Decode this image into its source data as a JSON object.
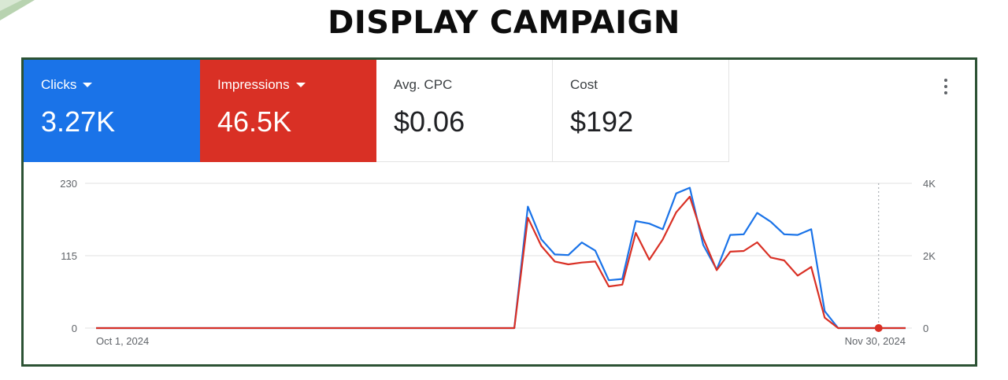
{
  "page": {
    "title": "DISPLAY CAMPAIGN"
  },
  "metrics": [
    {
      "label": "Clicks",
      "value": "3.27K",
      "color": "#1a73e8",
      "has_dropdown": true
    },
    {
      "label": "Impressions",
      "value": "46.5K",
      "color": "#d93025",
      "has_dropdown": true
    },
    {
      "label": "Avg. CPC",
      "value": "$0.06"
    },
    {
      "label": "Cost",
      "value": "$192"
    }
  ],
  "chart_data": {
    "type": "line",
    "x_start_label": "Oct 1, 2024",
    "x_end_label": "Nov 30, 2024",
    "days": 61,
    "left_axis": {
      "ticks": [
        "0",
        "115",
        "230"
      ],
      "ylim": [
        0,
        230
      ]
    },
    "right_axis": {
      "ticks": [
        "0",
        "2K",
        "4K"
      ],
      "ylim": [
        0,
        4000
      ]
    },
    "grid": true,
    "series": [
      {
        "axis": "left",
        "color": "#1a73e8",
        "values": [
          0,
          0,
          0,
          0,
          0,
          0,
          0,
          0,
          0,
          0,
          0,
          0,
          0,
          0,
          0,
          0,
          0,
          0,
          0,
          0,
          0,
          0,
          0,
          0,
          0,
          0,
          0,
          0,
          0,
          0,
          0,
          0,
          193,
          141,
          117,
          116,
          136,
          123,
          76,
          78,
          170,
          166,
          157,
          214,
          223,
          132,
          93,
          148,
          149,
          183,
          169,
          149,
          148,
          157,
          27,
          0,
          0,
          0,
          0,
          0,
          0
        ]
      },
      {
        "axis": "right",
        "color": "#d93025",
        "values": [
          0,
          0,
          0,
          0,
          0,
          0,
          0,
          0,
          0,
          0,
          0,
          0,
          0,
          0,
          0,
          0,
          0,
          0,
          0,
          0,
          0,
          0,
          0,
          0,
          0,
          0,
          0,
          0,
          0,
          0,
          0,
          0,
          3050,
          2270,
          1840,
          1760,
          1810,
          1840,
          1150,
          1200,
          2630,
          1890,
          2450,
          3200,
          3630,
          2480,
          1600,
          2110,
          2130,
          2370,
          1950,
          1870,
          1450,
          1690,
          290,
          0,
          0,
          0,
          0,
          0,
          0
        ]
      }
    ],
    "marker": {
      "date": "Nov 28, 2024",
      "value": 0
    }
  },
  "colors": {
    "blue": "#1a73e8",
    "red": "#d93025",
    "border": "#2c5234"
  },
  "icons": {
    "more": "more-vert-icon",
    "dropdown": "caret-down-icon"
  }
}
